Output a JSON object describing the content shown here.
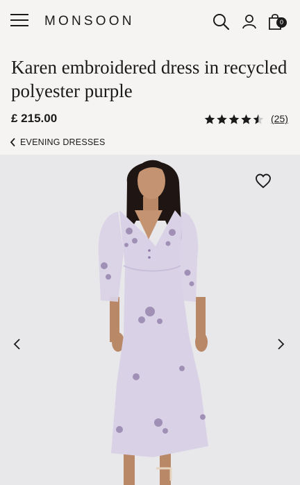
{
  "header": {
    "brand": "MONSOON",
    "bag_count": "0",
    "icons": [
      "menu-icon",
      "search-icon",
      "account-icon",
      "bag-icon"
    ]
  },
  "product": {
    "title": "Karen embroidered dress in recycled polyester purple",
    "price": "£ 215.00",
    "rating": 4.5,
    "rating_max": 5,
    "review_count": "(25)"
  },
  "breadcrumb": {
    "label": "EVENING DRESSES"
  },
  "gallery": {
    "image_subject": "model wearing lilac floral embroidered midi dress",
    "icons": [
      "heart-icon",
      "chevron-left-icon",
      "chevron-right-icon"
    ]
  },
  "colors": {
    "background": "#f5f4f2",
    "image_background": "#e8e7ea",
    "text": "#1a1a1a",
    "dress": "#d9d2e6"
  }
}
